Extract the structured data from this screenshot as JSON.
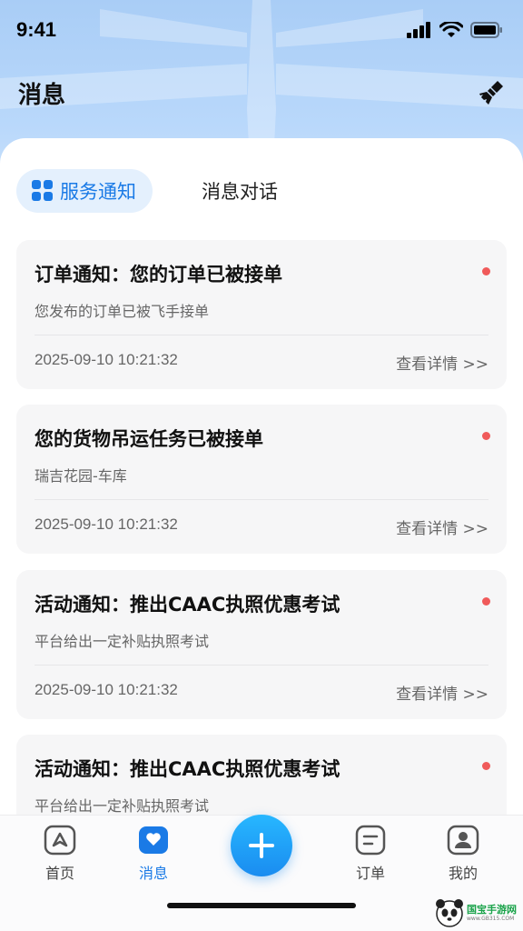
{
  "status_bar": {
    "time": "9:41"
  },
  "header": {
    "title": "消息"
  },
  "tabs": {
    "active": "服务通知",
    "inactive": "消息对话"
  },
  "messages": [
    {
      "title": "订单通知：您的订单已被接单",
      "subtitle": "您发布的订单已被飞手接单",
      "time": "2025-09-10 10:21:32",
      "link": "查看详情 >>"
    },
    {
      "title": "您的货物吊运任务已被接单",
      "subtitle": "瑞吉花园-车库",
      "time": "2025-09-10 10:21:32",
      "link": "查看详情 >>"
    },
    {
      "title": "活动通知：推出CAAC执照优惠考试",
      "subtitle": "平台给出一定补贴执照考试",
      "time": "2025-09-10 10:21:32",
      "link": "查看详情 >>"
    },
    {
      "title": "活动通知：推出CAAC执照优惠考试",
      "subtitle": "平台给出一定补贴执照考试",
      "time": "",
      "link": ""
    }
  ],
  "tabbar": {
    "home": "首页",
    "messages": "消息",
    "orders": "订单",
    "mine": "我的"
  },
  "watermark": {
    "name": "国宝手游网",
    "url": "www.GB315.COM"
  },
  "colors": {
    "accent": "#1a7ae6",
    "unread_dot": "#f05a5a",
    "header_bg": "#b9d8fb"
  }
}
